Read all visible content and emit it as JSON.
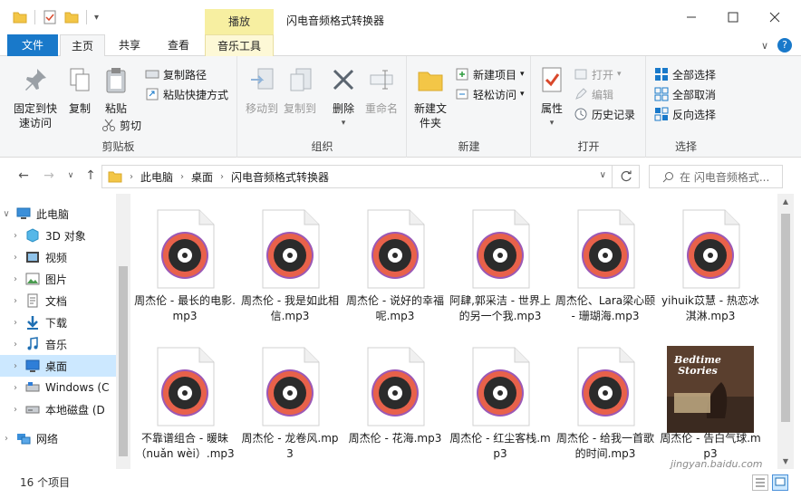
{
  "window": {
    "title": "闪电音频格式转换器",
    "context_tab_title": "播放"
  },
  "tabs": [
    {
      "label": "文件"
    },
    {
      "label": "主页"
    },
    {
      "label": "共享"
    },
    {
      "label": "查看"
    },
    {
      "label": "音乐工具"
    }
  ],
  "ribbon": {
    "clipboard": {
      "group_label": "剪贴板",
      "pin": "固定到快速访问",
      "copy": "复制",
      "paste": "粘贴",
      "copy_path": "复制路径",
      "paste_shortcut": "粘贴快捷方式",
      "cut": "剪切"
    },
    "organize": {
      "group_label": "组织",
      "move_to": "移动到",
      "copy_to": "复制到",
      "delete": "删除",
      "rename": "重命名"
    },
    "new": {
      "group_label": "新建",
      "new_folder": "新建文件夹",
      "new_item": "新建项目",
      "easy_access": "轻松访问"
    },
    "open": {
      "group_label": "打开",
      "properties": "属性",
      "open": "打开",
      "edit": "编辑",
      "history": "历史记录"
    },
    "select": {
      "group_label": "选择",
      "select_all": "全部选择",
      "select_none": "全部取消",
      "invert": "反向选择"
    }
  },
  "address": {
    "crumbs": [
      "此电脑",
      "桌面",
      "闪电音频格式转换器"
    ],
    "search_placeholder": "在 闪电音频格式..."
  },
  "nav_pane": [
    {
      "label": "此电脑",
      "icon": "computer-icon",
      "expanded": true
    },
    {
      "label": "3D 对象",
      "icon": "3d-objects-icon"
    },
    {
      "label": "视频",
      "icon": "video-icon"
    },
    {
      "label": "图片",
      "icon": "pictures-icon"
    },
    {
      "label": "文档",
      "icon": "documents-icon"
    },
    {
      "label": "下载",
      "icon": "downloads-icon"
    },
    {
      "label": "音乐",
      "icon": "music-icon"
    },
    {
      "label": "桌面",
      "icon": "desktop-icon",
      "selected": true
    },
    {
      "label": "Windows (C",
      "icon": "drive-icon"
    },
    {
      "label": "本地磁盘 (D",
      "icon": "drive-icon"
    },
    {
      "label": "网络",
      "icon": "network-icon"
    }
  ],
  "files": [
    {
      "name": "周杰伦 - 最长的电影.mp3",
      "icon": "audio-file-icon"
    },
    {
      "name": "周杰伦 - 我是如此相信.mp3",
      "icon": "audio-file-icon"
    },
    {
      "name": "周杰伦 - 说好的幸福呢.mp3",
      "icon": "audio-file-icon"
    },
    {
      "name": "阿肆,郭采洁 - 世界上的另一个我.mp3",
      "icon": "audio-file-icon"
    },
    {
      "name": "周杰伦、Lara梁心颐 - 珊瑚海.mp3",
      "icon": "audio-file-icon"
    },
    {
      "name": "yihuik苡慧 - 热恋冰淇淋.mp3",
      "icon": "audio-file-icon"
    },
    {
      "name": "不靠谱组合 - 暖昧（nuǎn wèi）.mp3",
      "icon": "audio-file-icon"
    },
    {
      "name": "周杰伦 - 龙卷风.mp3",
      "icon": "audio-file-icon"
    },
    {
      "name": "周杰伦 - 花海.mp3",
      "icon": "audio-file-icon"
    },
    {
      "name": "周杰伦 - 红尘客栈.mp3",
      "icon": "audio-file-icon"
    },
    {
      "name": "周杰伦 - 给我一首歌的时间.mp3",
      "icon": "audio-file-icon"
    },
    {
      "name": "周杰伦 - 告白气球.mp3",
      "icon": "album-art-icon",
      "cover_text": "Bedtime Stories"
    }
  ],
  "status": {
    "item_count": "16 个项目"
  },
  "watermark": "jingyan.baidu.com",
  "colors": {
    "accent": "#1979ca",
    "selection": "#cce8ff",
    "context_tab": "#f7efa1",
    "disc_ring": "#e8614a",
    "disc_ring2": "#9b59b6"
  }
}
